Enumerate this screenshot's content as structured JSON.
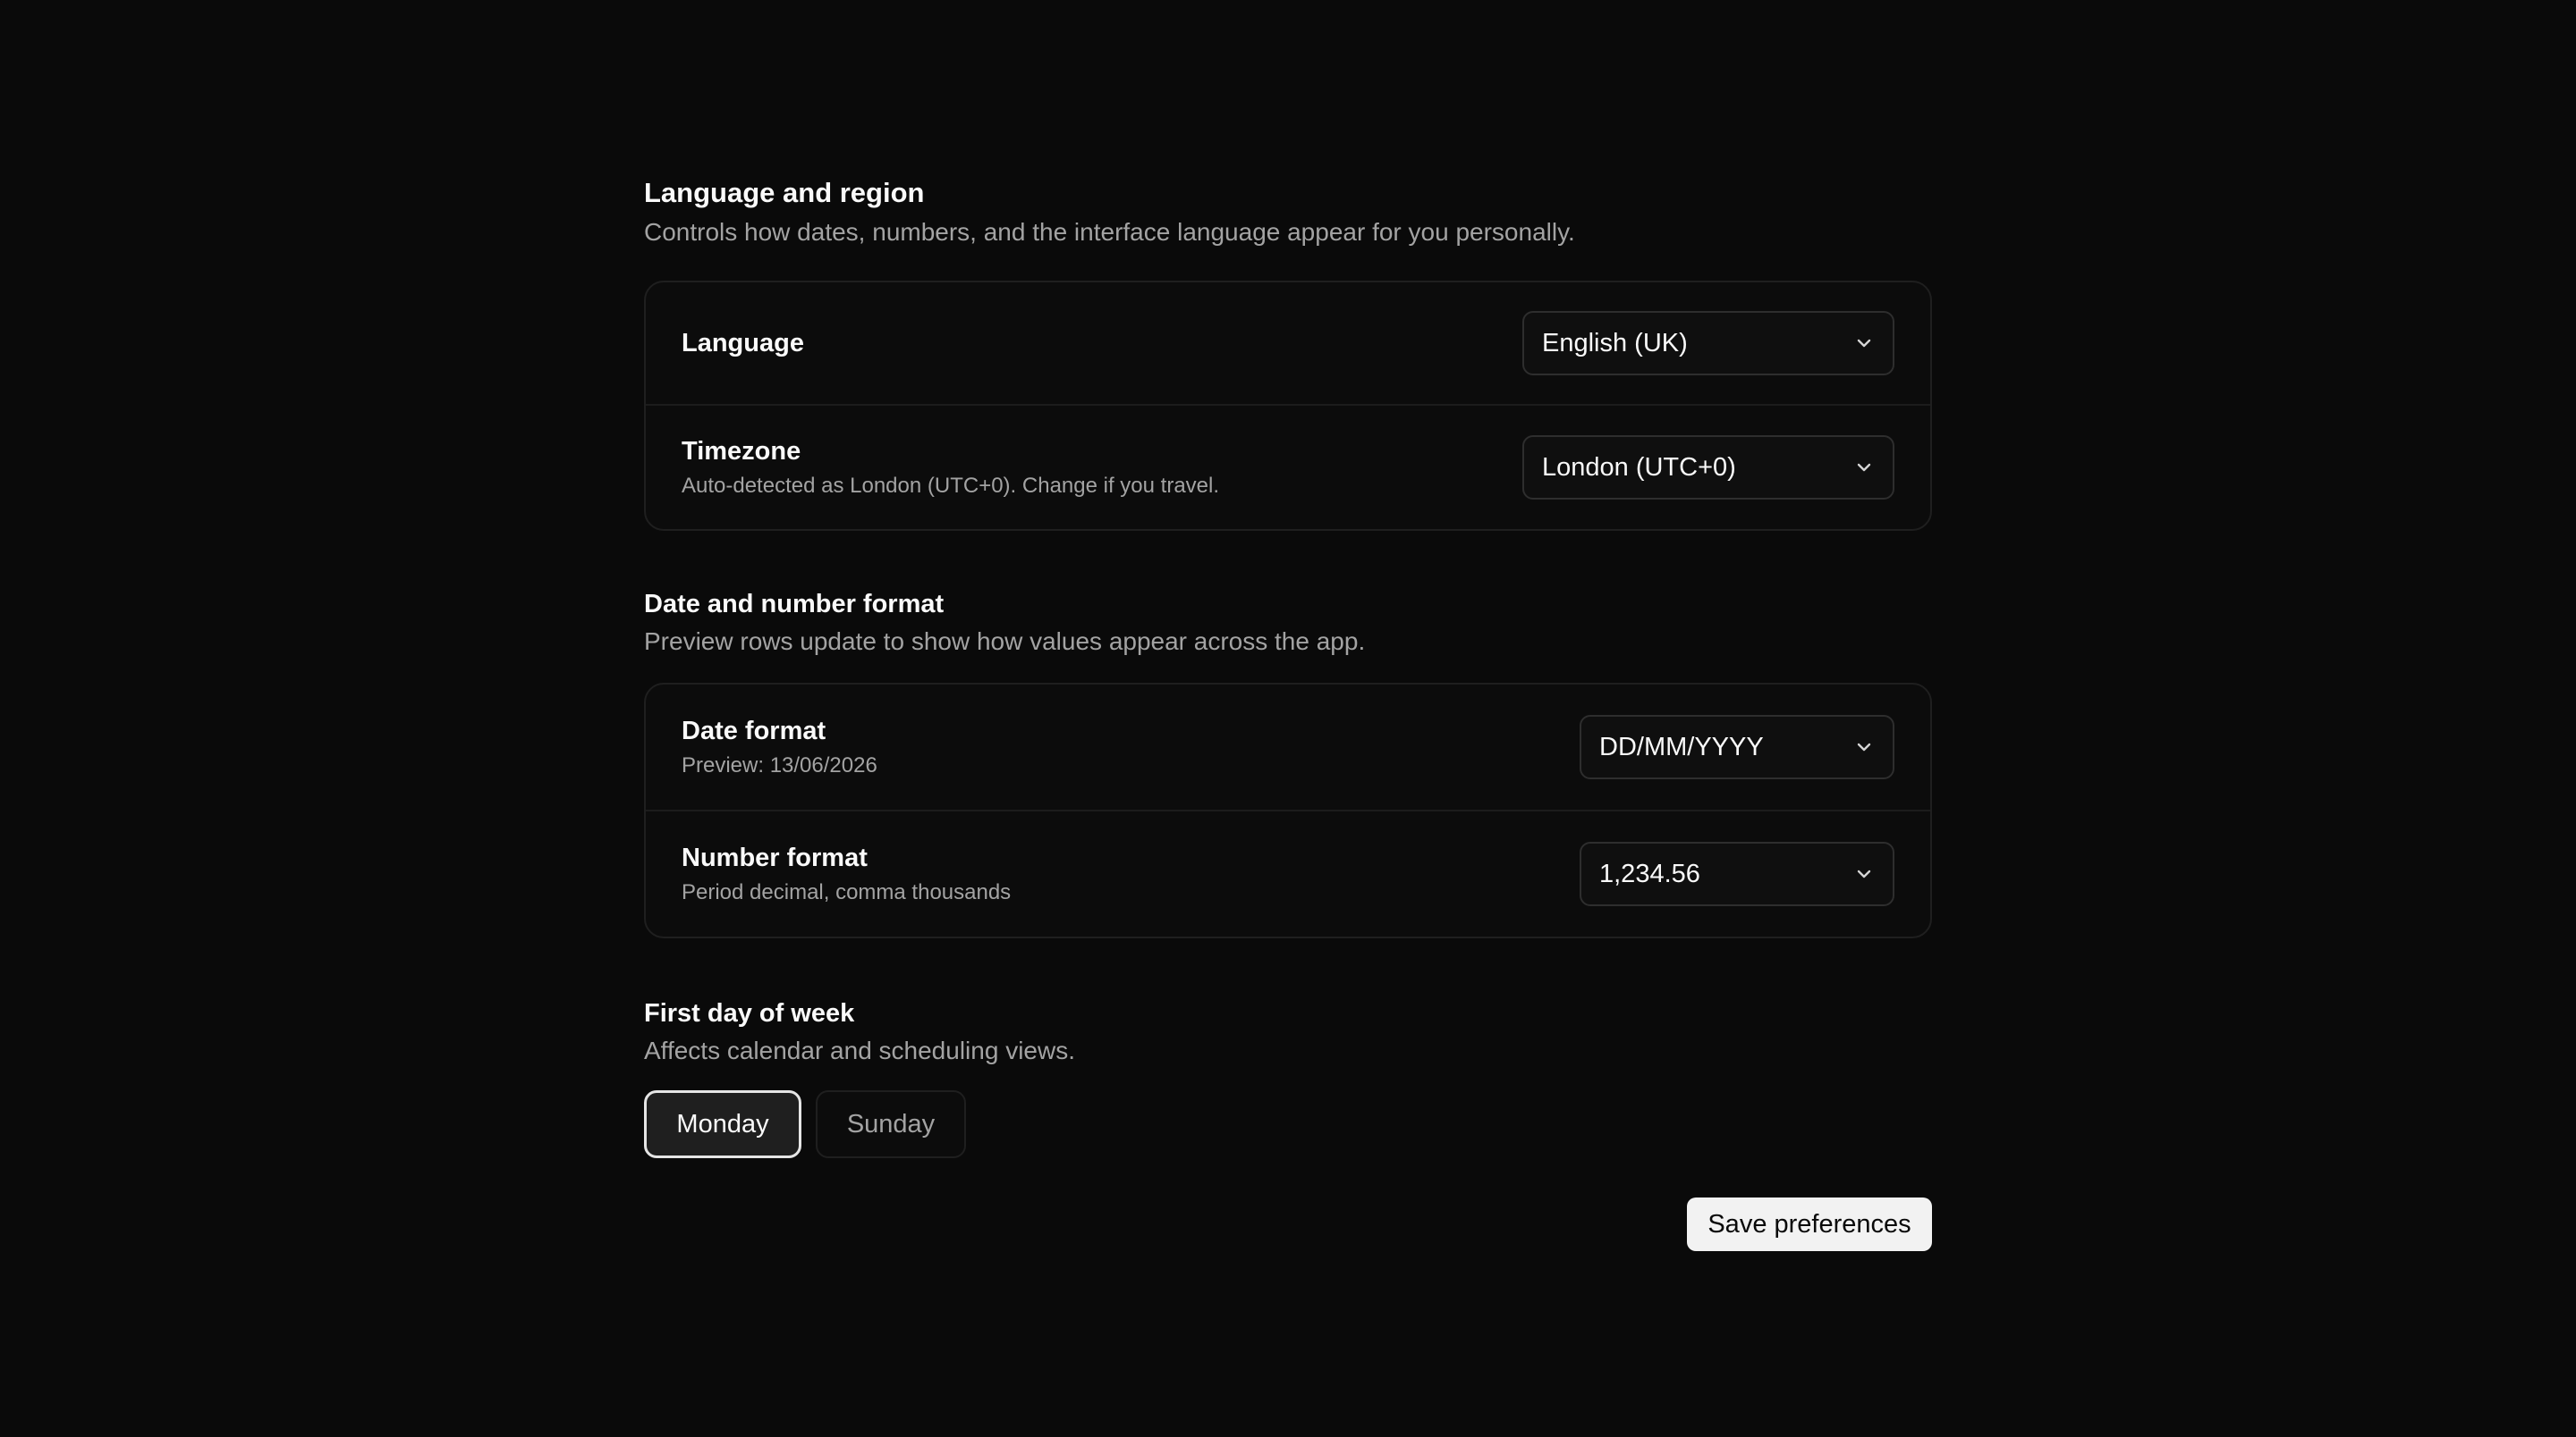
{
  "language_region": {
    "title": "Language and region",
    "description": "Controls how dates, numbers, and the interface language appear for you personally.",
    "language": {
      "label": "Language",
      "value": "English (UK)"
    },
    "timezone": {
      "label": "Timezone",
      "hint": "Auto-detected as London (UTC+0). Change if you travel.",
      "value": "London (UTC+0)"
    }
  },
  "date_number": {
    "title": "Date and number format",
    "description": "Preview rows update to show how values appear across the app.",
    "date_format": {
      "label": "Date format",
      "hint": "Preview: 13/06/2026",
      "value": "DD/MM/YYYY"
    },
    "number_format": {
      "label": "Number format",
      "hint": "Period decimal, comma thousands",
      "value": "1,234.56"
    }
  },
  "week": {
    "title": "First day of week",
    "description": "Affects calendar and scheduling views.",
    "options": [
      "Monday",
      "Sunday"
    ],
    "selected": "Monday"
  },
  "save_label": "Save preferences",
  "icons": {
    "dropdown": "chevron-down-icon"
  },
  "colors": {
    "background": "#0a0a0a",
    "primary_button": "#f2f2f2"
  }
}
